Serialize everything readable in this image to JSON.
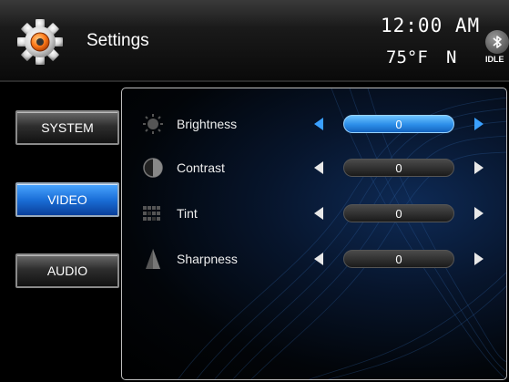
{
  "header": {
    "title": "Settings",
    "clock": "12:00 AM",
    "temperature": "75°F",
    "compass": "N",
    "bt_status": "IDLE",
    "icons": {
      "app": "gear-icon",
      "bluetooth": "bluetooth-icon"
    }
  },
  "sidebar": {
    "items": [
      {
        "label": "SYSTEM",
        "active": false
      },
      {
        "label": "VIDEO",
        "active": true
      },
      {
        "label": "AUDIO",
        "active": false
      }
    ]
  },
  "video": {
    "settings": [
      {
        "label": "Brightness",
        "value": "0",
        "selected": true,
        "icon": "brightness-icon"
      },
      {
        "label": "Contrast",
        "value": "0",
        "selected": false,
        "icon": "contrast-icon"
      },
      {
        "label": "Tint",
        "value": "0",
        "selected": false,
        "icon": "tint-icon"
      },
      {
        "label": "Sharpness",
        "value": "0",
        "selected": false,
        "icon": "sharpness-icon"
      }
    ]
  },
  "colors": {
    "accent": "#2b8de8",
    "arrow_highlight": "#3aa0ff",
    "panel_border": "#bdbdbd"
  }
}
